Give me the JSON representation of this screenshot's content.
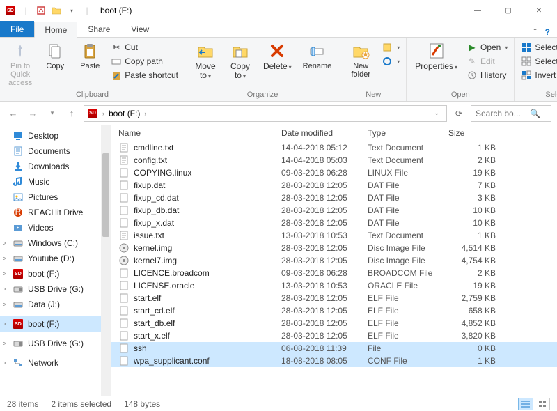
{
  "title": "boot (F:)",
  "titlebar_qat": {
    "save": "save-icon",
    "undo": "undo-icon"
  },
  "window_controls": {
    "min": "—",
    "max": "▢",
    "close": "✕"
  },
  "tabs": {
    "file": "File",
    "home": "Home",
    "share": "Share",
    "view": "View"
  },
  "ribbon": {
    "clipboard": {
      "label": "Clipboard",
      "pin": "Pin to Quick\naccess",
      "copy": "Copy",
      "paste": "Paste",
      "cut": "Cut",
      "copy_path": "Copy path",
      "paste_shortcut": "Paste shortcut"
    },
    "organize": {
      "label": "Organize",
      "move": "Move\nto",
      "copy": "Copy\nto",
      "delete": "Delete",
      "rename": "Rename"
    },
    "new": {
      "label": "New",
      "folder": "New\nfolder"
    },
    "open": {
      "label": "Open",
      "properties": "Properties",
      "open": "Open",
      "edit": "Edit",
      "history": "History"
    },
    "select": {
      "label": "Select",
      "all": "Select all",
      "none": "Select none",
      "invert": "Invert selection"
    }
  },
  "breadcrumb": {
    "root": "boot (F:)"
  },
  "search_placeholder": "Search bo...",
  "columns": {
    "name": "Name",
    "date": "Date modified",
    "type": "Type",
    "size": "Size"
  },
  "sidebar": [
    {
      "icon": "desktop",
      "label": "Desktop",
      "ind": 0
    },
    {
      "icon": "doc",
      "label": "Documents",
      "ind": 0
    },
    {
      "icon": "down",
      "label": "Downloads",
      "ind": 0
    },
    {
      "icon": "music",
      "label": "Music",
      "ind": 0
    },
    {
      "icon": "pic",
      "label": "Pictures",
      "ind": 0
    },
    {
      "icon": "reachit",
      "label": "REACHit Drive",
      "ind": 0
    },
    {
      "icon": "video",
      "label": "Videos",
      "ind": 0
    },
    {
      "icon": "disk",
      "label": "Windows (C:)",
      "ind": 0,
      "tw": ">"
    },
    {
      "icon": "disk",
      "label": "Youtube (D:)",
      "ind": 0,
      "tw": ">"
    },
    {
      "icon": "sd",
      "label": "boot (F:)",
      "ind": 0,
      "tw": ">"
    },
    {
      "icon": "usb",
      "label": "USB Drive (G:)",
      "ind": 0,
      "tw": ">"
    },
    {
      "icon": "disk",
      "label": "Data (J:)",
      "ind": 0,
      "tw": ">"
    },
    {
      "icon": "spacer",
      "label": "",
      "ind": 0
    },
    {
      "icon": "sd",
      "label": "boot (F:)",
      "ind": 0,
      "sel": true,
      "tw": ">"
    },
    {
      "icon": "spacer",
      "label": "",
      "ind": 0
    },
    {
      "icon": "usb",
      "label": "USB Drive (G:)",
      "ind": 0,
      "tw": ">"
    },
    {
      "icon": "spacer",
      "label": "",
      "ind": 0
    },
    {
      "icon": "net",
      "label": "Network",
      "ind": 0,
      "tw": ">"
    }
  ],
  "files": [
    {
      "n": "cmdline.txt",
      "d": "14-04-2018 05:12",
      "t": "Text Document",
      "s": "1 KB",
      "ic": "txt"
    },
    {
      "n": "config.txt",
      "d": "14-04-2018 05:03",
      "t": "Text Document",
      "s": "2 KB",
      "ic": "txt"
    },
    {
      "n": "COPYING.linux",
      "d": "09-03-2018 06:28",
      "t": "LINUX File",
      "s": "19 KB",
      "ic": "gen"
    },
    {
      "n": "fixup.dat",
      "d": "28-03-2018 12:05",
      "t": "DAT File",
      "s": "7 KB",
      "ic": "gen"
    },
    {
      "n": "fixup_cd.dat",
      "d": "28-03-2018 12:05",
      "t": "DAT File",
      "s": "3 KB",
      "ic": "gen"
    },
    {
      "n": "fixup_db.dat",
      "d": "28-03-2018 12:05",
      "t": "DAT File",
      "s": "10 KB",
      "ic": "gen"
    },
    {
      "n": "fixup_x.dat",
      "d": "28-03-2018 12:05",
      "t": "DAT File",
      "s": "10 KB",
      "ic": "gen"
    },
    {
      "n": "issue.txt",
      "d": "13-03-2018 10:53",
      "t": "Text Document",
      "s": "1 KB",
      "ic": "txt"
    },
    {
      "n": "kernel.img",
      "d": "28-03-2018 12:05",
      "t": "Disc Image File",
      "s": "4,514 KB",
      "ic": "img"
    },
    {
      "n": "kernel7.img",
      "d": "28-03-2018 12:05",
      "t": "Disc Image File",
      "s": "4,754 KB",
      "ic": "img"
    },
    {
      "n": "LICENCE.broadcom",
      "d": "09-03-2018 06:28",
      "t": "BROADCOM File",
      "s": "2 KB",
      "ic": "gen"
    },
    {
      "n": "LICENSE.oracle",
      "d": "13-03-2018 10:53",
      "t": "ORACLE File",
      "s": "19 KB",
      "ic": "gen"
    },
    {
      "n": "start.elf",
      "d": "28-03-2018 12:05",
      "t": "ELF File",
      "s": "2,759 KB",
      "ic": "gen"
    },
    {
      "n": "start_cd.elf",
      "d": "28-03-2018 12:05",
      "t": "ELF File",
      "s": "658 KB",
      "ic": "gen"
    },
    {
      "n": "start_db.elf",
      "d": "28-03-2018 12:05",
      "t": "ELF File",
      "s": "4,852 KB",
      "ic": "gen"
    },
    {
      "n": "start_x.elf",
      "d": "28-03-2018 12:05",
      "t": "ELF File",
      "s": "3,820 KB",
      "ic": "gen"
    },
    {
      "n": "ssh",
      "d": "06-08-2018 11:39",
      "t": "File",
      "s": "0 KB",
      "ic": "gen",
      "sel": true
    },
    {
      "n": "wpa_supplicant.conf",
      "d": "18-08-2018 08:05",
      "t": "CONF File",
      "s": "1 KB",
      "ic": "gen",
      "sel": true
    }
  ],
  "status": {
    "items": "28 items",
    "selected": "2 items selected",
    "bytes": "148 bytes"
  }
}
